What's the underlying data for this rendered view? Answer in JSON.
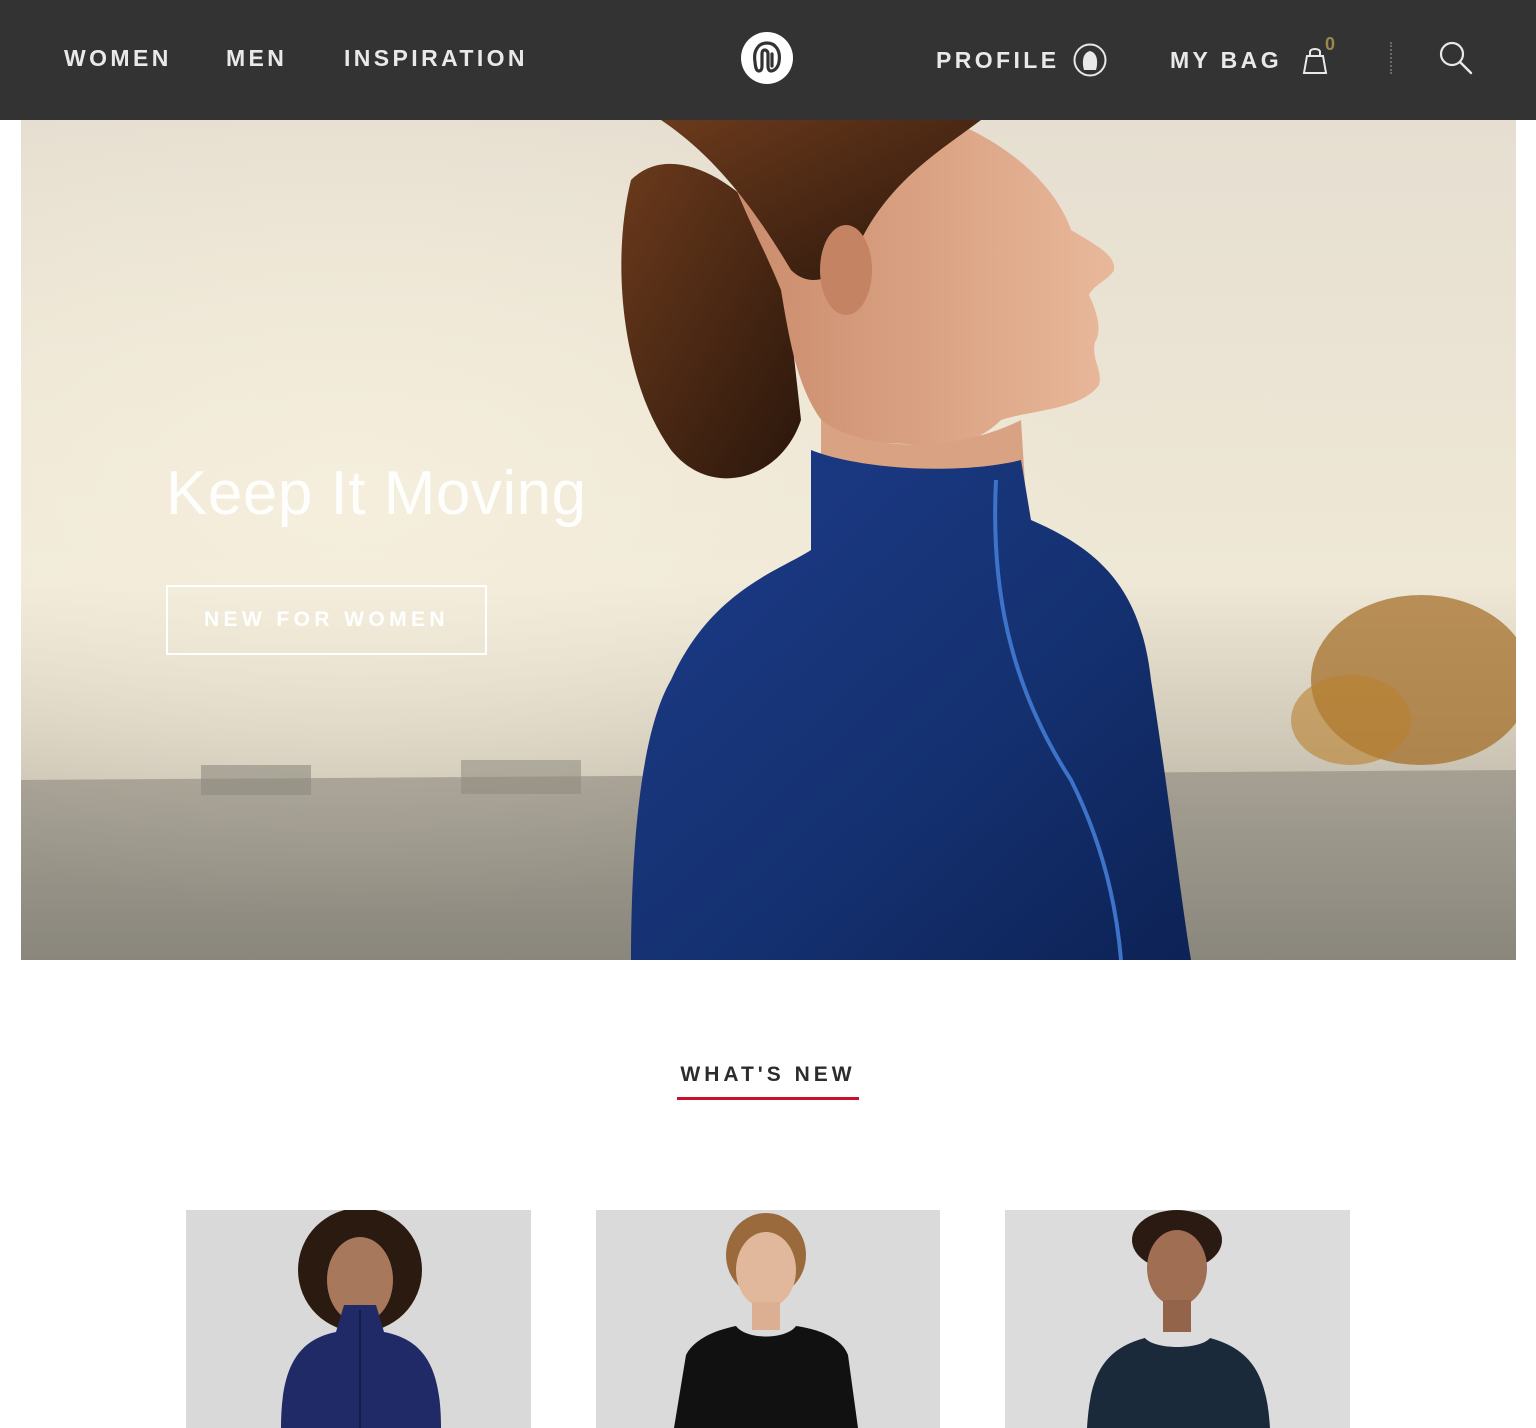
{
  "header": {
    "nav": [
      "WOMEN",
      "MEN",
      "INSPIRATION"
    ],
    "profile_label": "PROFILE",
    "bag_label": "MY BAG",
    "bag_count": "0",
    "logo_icon": "lululemon-logo-icon",
    "profile_icon": "user-avatar-icon",
    "bag_icon": "shopping-bag-icon",
    "search_icon": "search-icon"
  },
  "hero": {
    "title": "Keep It Moving",
    "cta_label": "NEW FOR WOMEN"
  },
  "whats_new": {
    "title": "WHAT'S NEW",
    "accent_color": "#c8102e"
  },
  "colors": {
    "header_bg": "#333333",
    "header_text": "#e9e9e9",
    "bag_count": "#9a8a4a"
  }
}
